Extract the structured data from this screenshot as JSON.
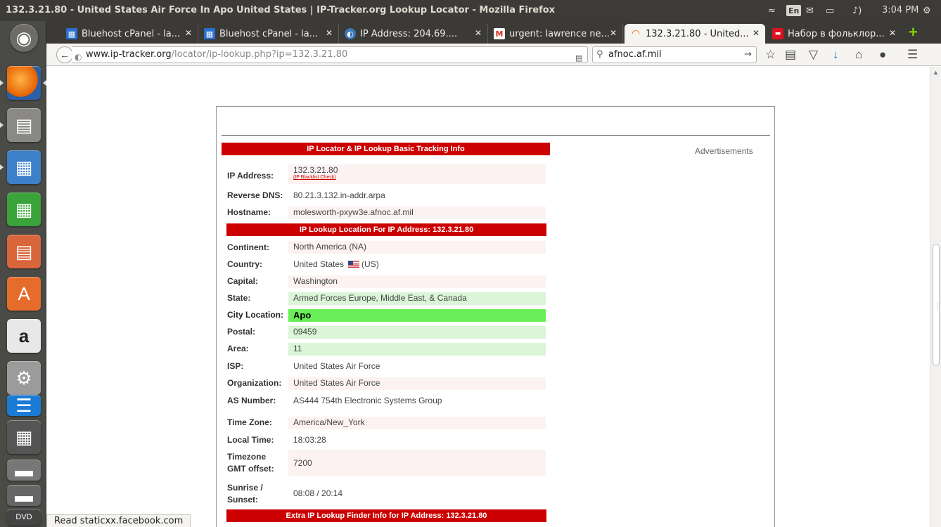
{
  "window": {
    "title": "132.3.21.80 - United States Air Force In Apo United States | IP-Tracker.org Lookup Locator - Mozilla Firefox",
    "clock": "3:04 PM",
    "keyboard_layout": "En"
  },
  "tabs": [
    {
      "label": "Bluehost cPanel - la...",
      "icon": "grid-icon",
      "active": false
    },
    {
      "label": "Bluehost cPanel - la...",
      "icon": "grid-icon",
      "active": false
    },
    {
      "label": "IP Address: 204.69....",
      "icon": "globe-icon",
      "active": false
    },
    {
      "label": "urgent: lawrence ne...",
      "icon": "gmail-icon",
      "active": false
    },
    {
      "label": "132.3.21.80 - United...",
      "icon": "loading-icon",
      "active": true
    },
    {
      "label": "Набор в фольклор...",
      "icon": "flag-icon",
      "active": false
    }
  ],
  "navbar": {
    "url_scheme_host": "www.ip-tracker.org",
    "url_path": "/locator/ip-lookup.php?ip=132.3.21.80",
    "search_value": "afnoc.af.mil"
  },
  "page": {
    "advertisements_label": "Advertisements",
    "sections": {
      "basic_title": "IP Locator & IP Lookup Basic Tracking Info",
      "location_title": "IP Lookup Location For IP Address: 132.3.21.80",
      "extra_title": "Extra IP Lookup Finder Info for IP Address: 132.3.21.80"
    },
    "basic": {
      "ip_label": "IP Address:",
      "ip_value": "132.3.21.80",
      "blacklist_link": "(IP Blacklist Check)",
      "rdns_label": "Reverse DNS:",
      "rdns_value": "80.21.3.132.in-addr.arpa",
      "hostname_label": "Hostname:",
      "hostname_value": "molesworth-pxyw3e.afnoc.af.mil"
    },
    "location": {
      "continent_label": "Continent:",
      "continent_value": "North America (NA)",
      "country_label": "Country:",
      "country_value": "United States",
      "country_code": "(US)",
      "capital_label": "Capital:",
      "capital_value": "Washington",
      "state_label": "State:",
      "state_value": "Armed Forces Europe, Middle East, & Canada",
      "city_label": "City Location:",
      "city_value": "Apo",
      "postal_label": "Postal:",
      "postal_value": "09459",
      "area_label": "Area:",
      "area_value": "11",
      "isp_label": "ISP:",
      "isp_value": "United States Air Force",
      "org_label": "Organization:",
      "org_value": "United States Air Force",
      "as_label": "AS Number:",
      "as_value": "AS444 754th Electronic Systems Group",
      "tz_label": "Time Zone:",
      "tz_value": "America/New_York",
      "localtime_label": "Local Time:",
      "localtime_value": "18:03:28",
      "gmt_label_1": "Timezone",
      "gmt_label_2": "GMT offset:",
      "gmt_value": "7200",
      "sun_label_1": "Sunrise /",
      "sun_label_2": "Sunset:",
      "sun_value": "08:08 / 20:14"
    }
  },
  "status_bar": "Read staticxx.facebook.com"
}
